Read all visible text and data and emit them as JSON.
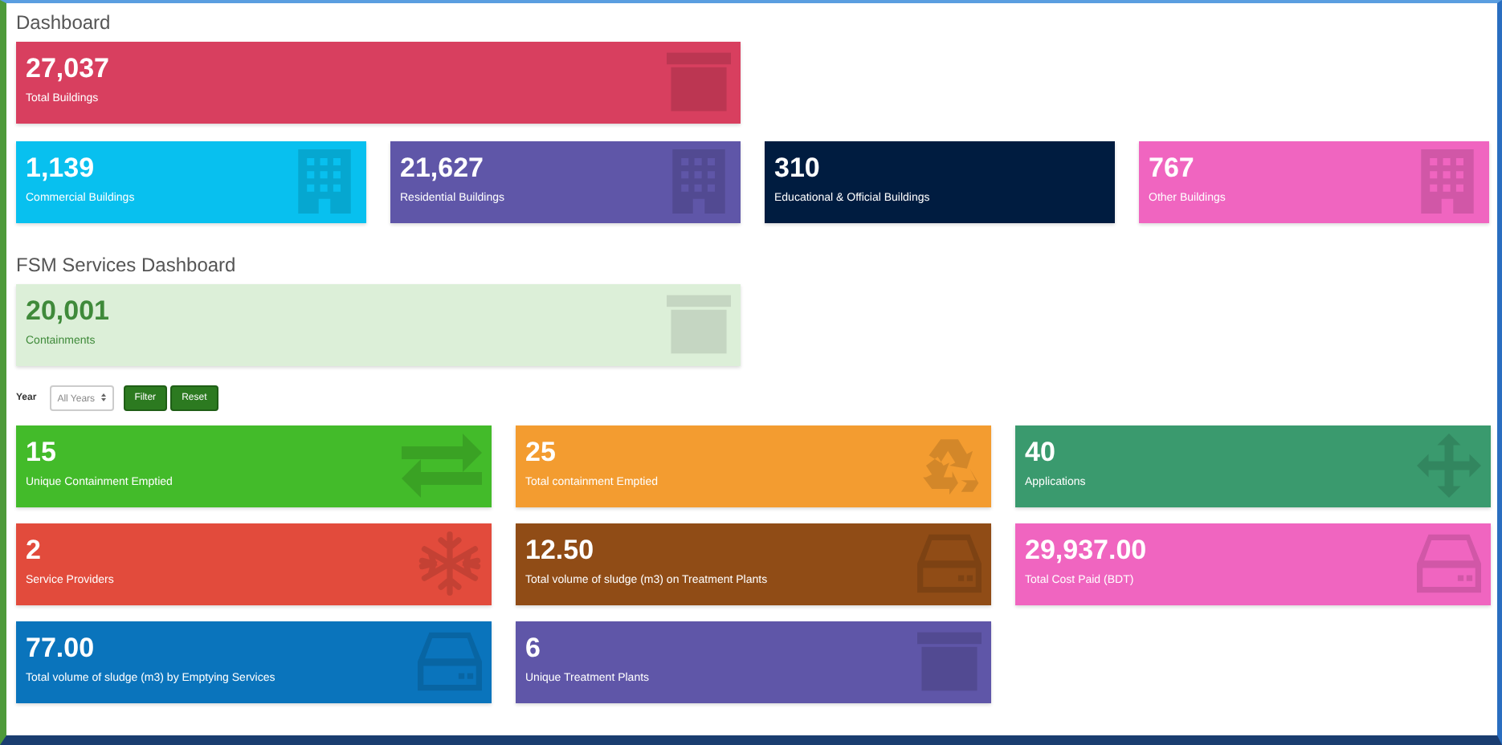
{
  "dashboard": {
    "title": "Dashboard",
    "total": {
      "value": "27,037",
      "label": "Total Buildings",
      "color": "#d83f5f"
    },
    "buildings": [
      {
        "value": "1,139",
        "label": "Commercial Buildings",
        "color": "#08c0ef"
      },
      {
        "value": "21,627",
        "label": "Residential Buildings",
        "color": "#5f56a8"
      },
      {
        "value": "310",
        "label": "Educational & Official Buildings",
        "color": "#001c40"
      },
      {
        "value": "767",
        "label": "Other Buildings",
        "color": "#f065c0"
      }
    ]
  },
  "fsm": {
    "title": "FSM Services Dashboard",
    "containments": {
      "value": "20,001",
      "label": "Containments"
    },
    "filter": {
      "label": "Year",
      "select": "All Years",
      "buttons": [
        "Filter",
        "Reset"
      ]
    },
    "cards": [
      {
        "value": "15",
        "label": "Unique Containment Emptied",
        "color": "#43bb2a"
      },
      {
        "value": "25",
        "label": "Total containment Emptied",
        "color": "#f39c30"
      },
      {
        "value": "40",
        "label": "Applications",
        "color": "#3a9a6e"
      },
      {
        "value": "2",
        "label": "Service Providers",
        "color": "#e24b3c"
      },
      {
        "value": "12.50",
        "label": "Total volume of sludge (m3) on Treatment Plants",
        "color": "#904c16"
      },
      {
        "value": "29,937.00",
        "label": "Total Cost Paid (BDT)",
        "color": "#f065c0"
      },
      {
        "value": "77.00",
        "label": "Total volume of sludge (m3) by Emptying Services",
        "color": "#0a74bc"
      },
      {
        "value": "6",
        "label": "Unique Treatment Plants",
        "color": "#5f56a8"
      }
    ]
  }
}
